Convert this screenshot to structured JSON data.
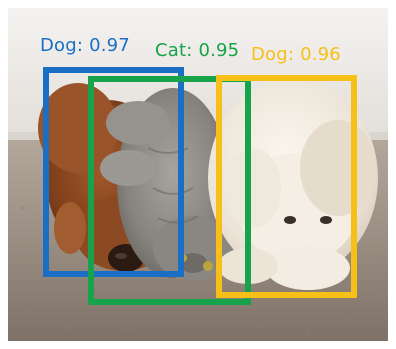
{
  "image": {
    "subject": "Two dogs and a cat lying together on a carpet",
    "colors": {
      "wall": "#eeebe8",
      "carpet": "#9c8f84",
      "red_dog": "#8a4a22",
      "cat": "#8d8a86",
      "white_dog": "#ede6da"
    }
  },
  "detections": [
    {
      "label": "Dog: 0.97",
      "class": "Dog",
      "score": 0.97,
      "color": "#1a6fc4"
    },
    {
      "label": "Cat: 0.95",
      "class": "Cat",
      "score": 0.95,
      "color": "#17a34a"
    },
    {
      "label": "Dog: 0.96",
      "class": "Dog",
      "score": 0.96,
      "color": "#f6c018"
    }
  ]
}
